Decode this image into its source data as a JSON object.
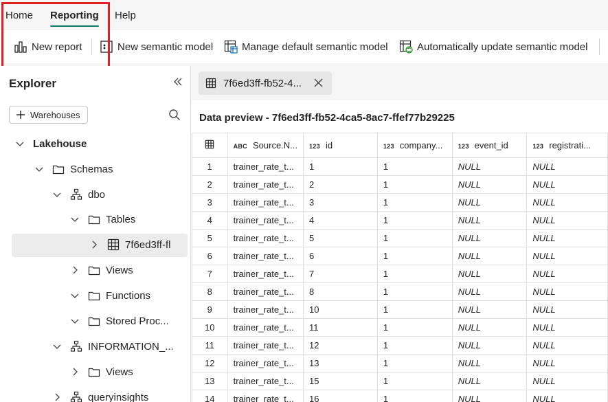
{
  "menu": {
    "tabs": [
      {
        "label": "Home"
      },
      {
        "label": "Reporting"
      },
      {
        "label": "Help"
      }
    ]
  },
  "ribbon": {
    "new_report": "New report",
    "new_semantic_model": "New semantic model",
    "manage_default_semantic_model": "Manage default semantic model",
    "auto_update_semantic_model": "Automatically update semantic model"
  },
  "explorer": {
    "title": "Explorer",
    "warehouses_button": "Warehouses",
    "tree": [
      {
        "label": "Lakehouse",
        "icon": "none",
        "chevron": "down"
      },
      {
        "label": "Schemas",
        "icon": "folder-icon",
        "chevron": "down"
      },
      {
        "label": "dbo",
        "icon": "schema-icon",
        "chevron": "down"
      },
      {
        "label": "Tables",
        "icon": "folder-icon",
        "chevron": "down"
      },
      {
        "label": "7f6ed3ff-fl",
        "icon": "table-icon",
        "chevron": "right"
      },
      {
        "label": "Views",
        "icon": "folder-icon",
        "chevron": "right"
      },
      {
        "label": "Functions",
        "icon": "folder-icon",
        "chevron": "down"
      },
      {
        "label": "Stored Proc...",
        "icon": "folder-icon",
        "chevron": "down"
      },
      {
        "label": "INFORMATION_...",
        "icon": "schema-icon",
        "chevron": "down"
      },
      {
        "label": "Views",
        "icon": "folder-icon",
        "chevron": "right"
      },
      {
        "label": "queryinsights",
        "icon": "schema-icon",
        "chevron": "right"
      }
    ]
  },
  "main": {
    "tab_label": "7f6ed3ff-fb52-4...",
    "preview_title": "Data preview - 7f6ed3ff-fb52-4ca5-8ac7-ffef77b29225",
    "columns": [
      {
        "type": "ABC",
        "label": "Source.N..."
      },
      {
        "type": "123",
        "label": "id"
      },
      {
        "type": "123",
        "label": "company..."
      },
      {
        "type": "123",
        "label": "event_id"
      },
      {
        "type": "123",
        "label": "registrati..."
      }
    ],
    "rows": [
      [
        "1",
        "trainer_rate_t...",
        "1",
        "1",
        "NULL",
        "NULL"
      ],
      [
        "2",
        "trainer_rate_t...",
        "2",
        "1",
        "NULL",
        "NULL"
      ],
      [
        "3",
        "trainer_rate_t...",
        "3",
        "1",
        "NULL",
        "NULL"
      ],
      [
        "4",
        "trainer_rate_t...",
        "4",
        "1",
        "NULL",
        "NULL"
      ],
      [
        "5",
        "trainer_rate_t...",
        "5",
        "1",
        "NULL",
        "NULL"
      ],
      [
        "6",
        "trainer_rate_t...",
        "6",
        "1",
        "NULL",
        "NULL"
      ],
      [
        "7",
        "trainer_rate_t...",
        "7",
        "1",
        "NULL",
        "NULL"
      ],
      [
        "8",
        "trainer_rate_t...",
        "8",
        "1",
        "NULL",
        "NULL"
      ],
      [
        "9",
        "trainer_rate_t...",
        "10",
        "1",
        "NULL",
        "NULL"
      ],
      [
        "10",
        "trainer_rate_t...",
        "11",
        "1",
        "NULL",
        "NULL"
      ],
      [
        "11",
        "trainer_rate_t...",
        "12",
        "1",
        "NULL",
        "NULL"
      ],
      [
        "12",
        "trainer_rate_t...",
        "13",
        "1",
        "NULL",
        "NULL"
      ],
      [
        "13",
        "trainer_rate_t...",
        "15",
        "1",
        "NULL",
        "NULL"
      ],
      [
        "14",
        "trainer_rate_t...",
        "16",
        "1",
        "NULL",
        "NULL"
      ]
    ]
  },
  "colors": {
    "accent": "#117865",
    "highlight": "#e02020"
  }
}
